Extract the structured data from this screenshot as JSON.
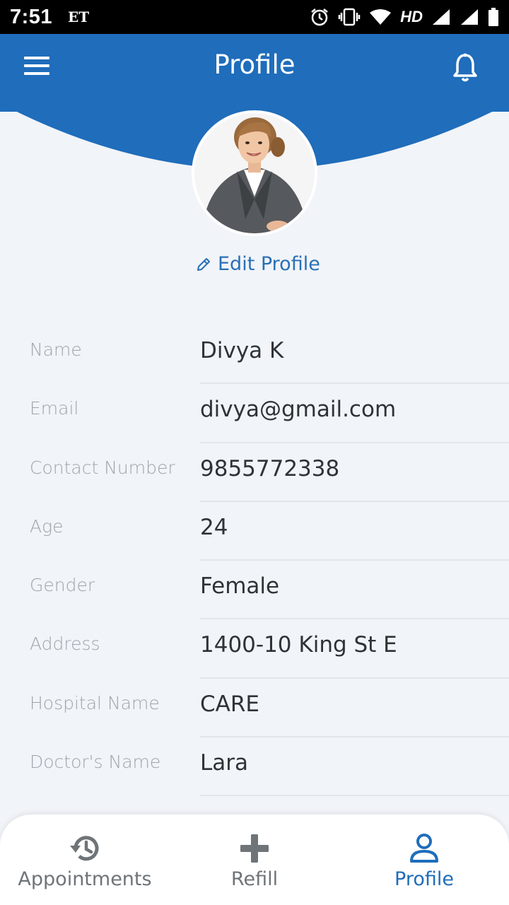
{
  "status_bar": {
    "time": "7:51",
    "carrier": "ET",
    "network": "HD"
  },
  "header": {
    "title": "Profile",
    "menu_icon": "hamburger-menu-icon",
    "bell_icon": "bell-icon",
    "color": "#1f6dbb"
  },
  "profile": {
    "edit_label": "Edit Profile",
    "edit_icon": "pencil-icon"
  },
  "fields": [
    {
      "label": "Name",
      "value": "Divya K"
    },
    {
      "label": "Email",
      "value": "divya@gmail.com"
    },
    {
      "label": "Contact Number",
      "value": "9855772338"
    },
    {
      "label": "Age",
      "value": "24"
    },
    {
      "label": "Gender",
      "value": "Female"
    },
    {
      "label": "Address",
      "value": "1400-10 King St E"
    },
    {
      "label": "Hospital Name",
      "value": "CARE"
    },
    {
      "label": "Doctor's Name",
      "value": "Lara"
    }
  ],
  "bottom_nav": {
    "items": [
      {
        "label": "Appointments",
        "icon": "history-icon",
        "active": false
      },
      {
        "label": "Refill",
        "icon": "plus-icon",
        "active": false
      },
      {
        "label": "Profile",
        "icon": "user-icon",
        "active": true
      }
    ],
    "active_color": "#1f6dbb",
    "inactive_color": "#6f7478"
  }
}
